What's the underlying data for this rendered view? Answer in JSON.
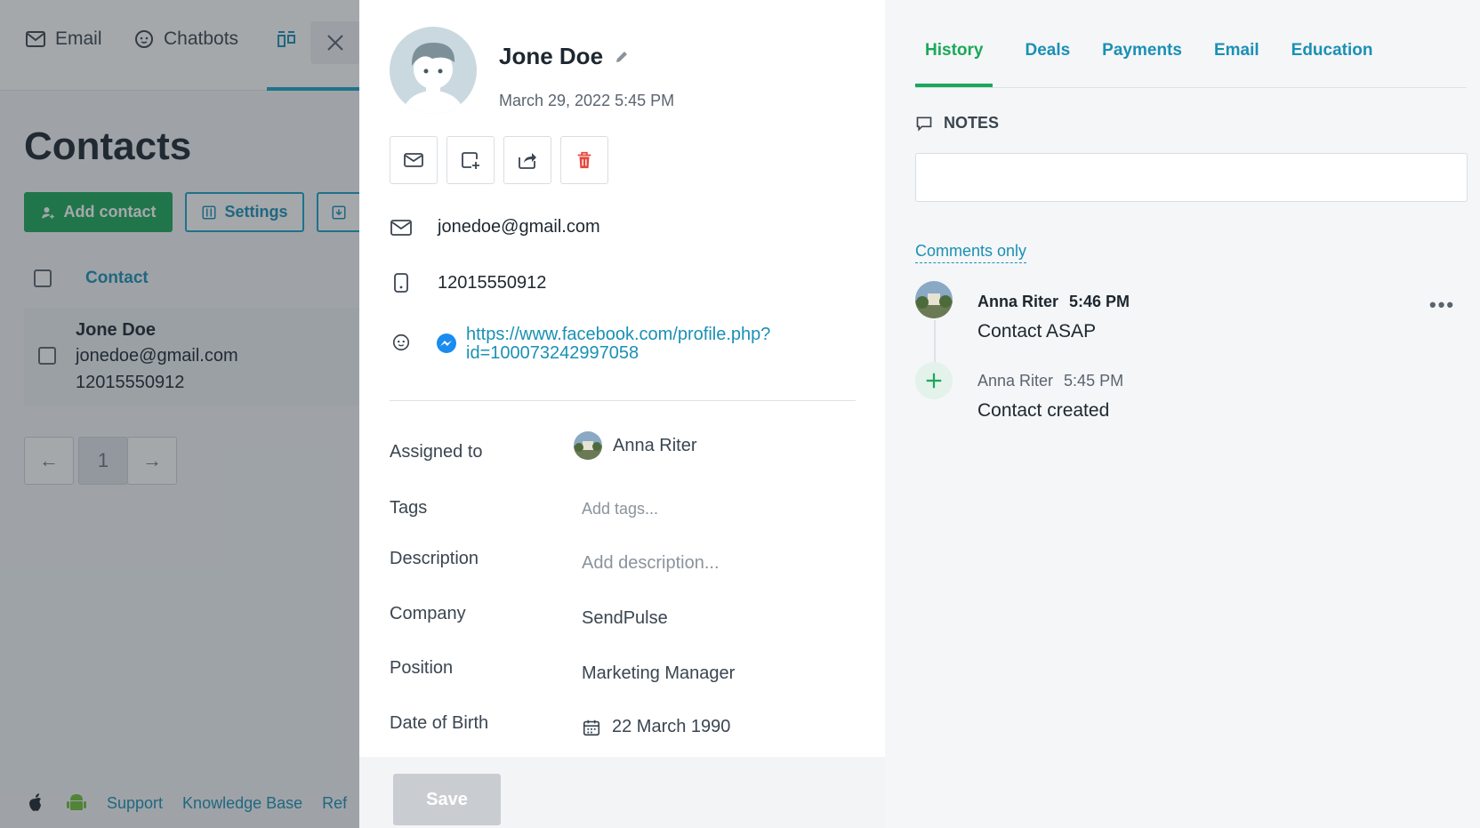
{
  "background": {
    "nav": {
      "email": "Email",
      "chatbots": "Chatbots"
    },
    "page_title": "Contacts",
    "add_contact": "Add contact",
    "settings": "Settings",
    "column_contact": "Contact",
    "contact": {
      "name": "Jone Doe",
      "email": "jonedoe@gmail.com",
      "phone": "12015550912"
    },
    "pager": {
      "prev": "←",
      "page": "1",
      "next": "→"
    },
    "footer": {
      "support": "Support",
      "kb": "Knowledge Base",
      "ref": "Ref"
    }
  },
  "card": {
    "name": "Jone Doe",
    "date": "March 29, 2022 5:45 PM",
    "email": "jonedoe@gmail.com",
    "phone": "12015550912",
    "facebook": "https://www.facebook.com/profile.php?id=100073242997058",
    "fields": {
      "assigned_label": "Assigned to",
      "assigned_value": "Anna Riter",
      "tags_label": "Tags",
      "tags_placeholder": "Add tags...",
      "description_label": "Description",
      "description_placeholder": "Add description...",
      "company_label": "Company",
      "company_value": "SendPulse",
      "position_label": "Position",
      "position_value": "Marketing Manager",
      "dob_label": "Date of Birth",
      "dob_value": "22 March 1990"
    },
    "save": "Save"
  },
  "history": {
    "tabs": [
      "History",
      "Deals",
      "Payments",
      "Email",
      "Education"
    ],
    "notes_label": "NOTES",
    "comments_only": "Comments only",
    "entries": [
      {
        "author": "Anna Riter",
        "time": "5:46 PM",
        "text": "Contact ASAP"
      },
      {
        "author": "Anna Riter",
        "time": "5:45 PM",
        "text": "Contact created"
      }
    ],
    "more": "•••"
  },
  "colors": {
    "accent": "#1a90b5",
    "green": "#1aa85a",
    "delete": "#e5483d"
  }
}
